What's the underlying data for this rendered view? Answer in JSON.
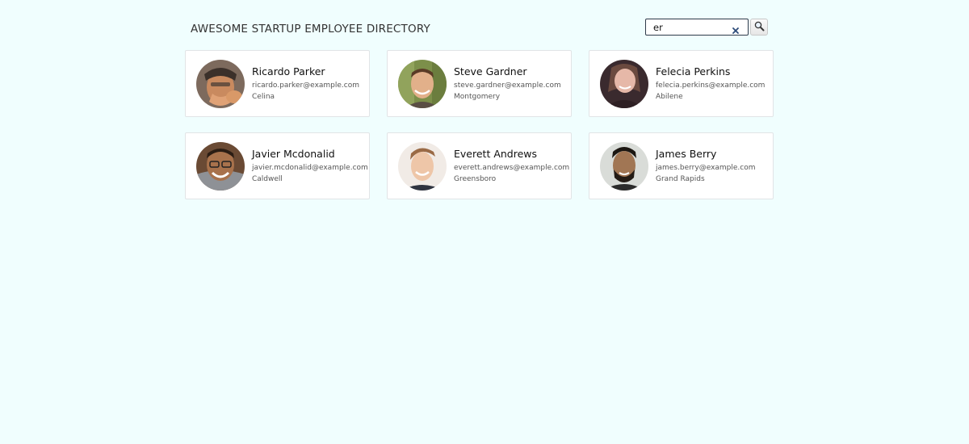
{
  "header": {
    "title": "AWESOME STARTUP EMPLOYEE DIRECTORY"
  },
  "search": {
    "value": "er",
    "clear_icon": "close-icon",
    "button_icon": "search-icon"
  },
  "colors": {
    "background": "#f0fefe",
    "card_background": "#ffffff",
    "card_border": "#e1e4e6",
    "clear_icon": "#2c4a78"
  },
  "employees": [
    {
      "name": "Ricardo Parker",
      "email": "ricardo.parker@example.com",
      "city": "Celina"
    },
    {
      "name": "Steve Gardner",
      "email": "steve.gardner@example.com",
      "city": "Montgomery"
    },
    {
      "name": "Felecia Perkins",
      "email": "felecia.perkins@example.com",
      "city": "Abilene"
    },
    {
      "name": "Javier Mcdonalid",
      "email": "javier.mcdonalid@example.com",
      "city": "Caldwell"
    },
    {
      "name": "Everett Andrews",
      "email": "everett.andrews@example.com",
      "city": "Greensboro"
    },
    {
      "name": "James Berry",
      "email": "james.berry@example.com",
      "city": "Grand Rapids"
    }
  ]
}
